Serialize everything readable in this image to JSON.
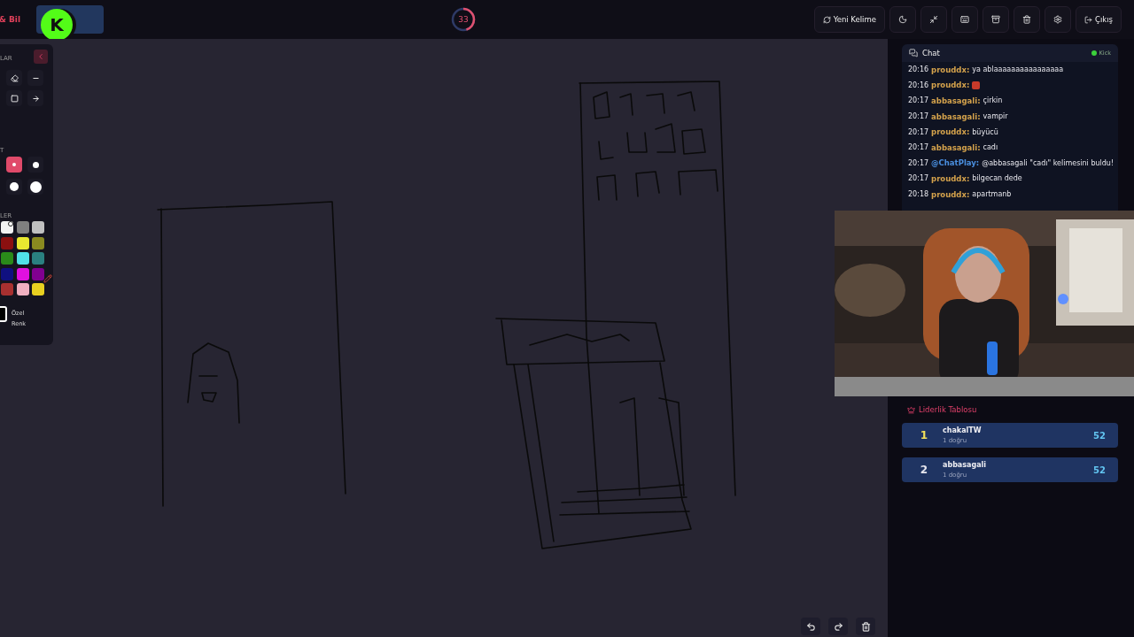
{
  "header": {
    "brand": "& Bil",
    "badge": "K",
    "timer": {
      "value": "33",
      "level": 0.45
    },
    "buttons": [
      {
        "kind": "refresh",
        "label": "Yeni Kelime"
      },
      {
        "kind": "moon"
      },
      {
        "kind": "compress"
      },
      {
        "kind": "keyboard"
      },
      {
        "kind": "archive"
      },
      {
        "kind": "trash"
      },
      {
        "kind": "gear"
      },
      {
        "kind": "exit",
        "label": "Çıkış"
      }
    ]
  },
  "tool_panel": {
    "tools_heading": "LAR",
    "tools": [
      {
        "kind": "eraser",
        "selected": false
      },
      {
        "kind": "line",
        "selected": false
      },
      {
        "kind": "square",
        "selected": false
      },
      {
        "kind": "arrow",
        "selected": false
      }
    ],
    "size_heading": "T",
    "sizes": [
      {
        "kind": "xs",
        "selected": true
      },
      {
        "kind": "s",
        "selected": false
      },
      {
        "kind": "m",
        "selected": false
      },
      {
        "kind": "l",
        "selected": false
      }
    ],
    "colors_heading": "LER",
    "colors": [
      {
        "color": "#f2f2f2",
        "selected": true
      },
      {
        "color": "#808080",
        "selected": false
      },
      {
        "color": "#c0c0c0",
        "selected": false
      },
      {
        "color": "#8b1010",
        "selected": false
      },
      {
        "color": "#e8e830",
        "selected": false
      },
      {
        "color": "#8a8a20",
        "selected": false
      },
      {
        "color": "#2a8a1a",
        "selected": false
      },
      {
        "color": "#50e0e8",
        "selected": false
      },
      {
        "color": "#2a8080",
        "selected": false
      },
      {
        "color": "#101080",
        "selected": false
      },
      {
        "color": "#e010e0",
        "selected": false
      },
      {
        "color": "#800090",
        "selected": false
      },
      {
        "color": "#a83030",
        "selected": false
      },
      {
        "color": "#f0b0c0",
        "selected": false
      },
      {
        "color": "#e8d020",
        "selected": false
      }
    ],
    "custom_color": "Özel Renk"
  },
  "canvas_controls": [
    {
      "kind": "undo"
    },
    {
      "kind": "redo"
    },
    {
      "kind": "trash"
    }
  ],
  "chat": {
    "title": "Chat",
    "platform": "Kick",
    "live": true,
    "messages": [
      {
        "time": "20:16",
        "user": "prouddx:",
        "color": "#d4a24c",
        "kind": "text",
        "text": "ya ablaaaaaaaaaaaaaaaa"
      },
      {
        "time": "20:16",
        "user": "prouddx:",
        "color": "#d4a24c",
        "kind": "emoji"
      },
      {
        "time": "20:17",
        "user": "abbasagali:",
        "color": "#d4a24c",
        "kind": "text",
        "text": "çirkin"
      },
      {
        "time": "20:17",
        "user": "abbasagali:",
        "color": "#d4a24c",
        "kind": "text",
        "text": "vampir"
      },
      {
        "time": "20:17",
        "user": "prouddx:",
        "color": "#d4a24c",
        "kind": "text",
        "text": "büyücü"
      },
      {
        "time": "20:17",
        "user": "abbasagali:",
        "color": "#d4a24c",
        "kind": "text",
        "text": "cadı"
      },
      {
        "time": "20:17",
        "user": "@ChatPlay:",
        "color": "#4a8fe0",
        "kind": "text",
        "text": "@abbasagali \"cadı\" kelimesini buldu!"
      },
      {
        "time": "20:17",
        "user": "prouddx:",
        "color": "#d4a24c",
        "kind": "text",
        "text": "bilgecan dede"
      },
      {
        "time": "20:18",
        "user": "prouddx:",
        "color": "#d4a24c",
        "kind": "text",
        "text": "apartmanb"
      }
    ]
  },
  "leaderboard": {
    "title": "Liderlik Tablosu",
    "rows": [
      {
        "rank": "1",
        "color": "#f2e05a",
        "name": "chakalTW",
        "subtitle": "1 doğru",
        "score": "52"
      },
      {
        "rank": "2",
        "color": "#e6e6ee",
        "name": "abbasagali",
        "subtitle": "1 doğru",
        "score": "52"
      }
    ]
  }
}
